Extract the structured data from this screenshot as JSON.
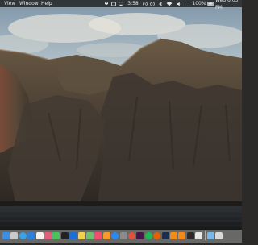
{
  "menubar": {
    "menus": [
      "View",
      "Window",
      "Help"
    ],
    "status": {
      "battery_percent": "100%",
      "time_text": "3:58",
      "datetime": "Wed 6:03 PM"
    }
  },
  "dock": {
    "apps": [
      {
        "name": "finder-icon",
        "color": "#3a8ee6"
      },
      {
        "name": "launchpad-icon",
        "color": "#c9c9c9"
      },
      {
        "name": "safari-icon",
        "color": "#3aa0e8"
      },
      {
        "name": "mail-icon",
        "color": "#2f7fd6"
      },
      {
        "name": "calendar-icon",
        "color": "#f2f2f2"
      },
      {
        "name": "photos-icon",
        "color": "#e0607a"
      },
      {
        "name": "messages-icon",
        "color": "#4cc15a"
      },
      {
        "name": "terminal-icon",
        "color": "#222222"
      },
      {
        "name": "code-editor-icon",
        "color": "#1b6fd1"
      },
      {
        "name": "notes-icon",
        "color": "#f1d04b"
      },
      {
        "name": "maps-icon",
        "color": "#6cc16a"
      },
      {
        "name": "music-icon",
        "color": "#f04e6c"
      },
      {
        "name": "books-icon",
        "color": "#f39b2e"
      },
      {
        "name": "app-store-icon",
        "color": "#2a8af5"
      },
      {
        "name": "preferences-icon",
        "color": "#8b8b8b"
      },
      {
        "name": "chrome-icon",
        "color": "#e3503d"
      },
      {
        "name": "slack-icon",
        "color": "#4a154b"
      },
      {
        "name": "spotify-icon",
        "color": "#1db954"
      },
      {
        "name": "firefox-icon",
        "color": "#e66000"
      },
      {
        "name": "photoshop-icon",
        "color": "#1b2f4b"
      },
      {
        "name": "illustrator-icon",
        "color": "#f08c1a"
      },
      {
        "name": "vlc-icon",
        "color": "#f08a1d"
      },
      {
        "name": "activity-monitor-icon",
        "color": "#2a2a2a"
      },
      {
        "name": "reminders-icon",
        "color": "#e8e8e8"
      }
    ],
    "trailing": [
      {
        "name": "downloads-folder-icon",
        "color": "#7ab7e6"
      },
      {
        "name": "trash-icon",
        "color": "#d9d9d9"
      }
    ]
  }
}
